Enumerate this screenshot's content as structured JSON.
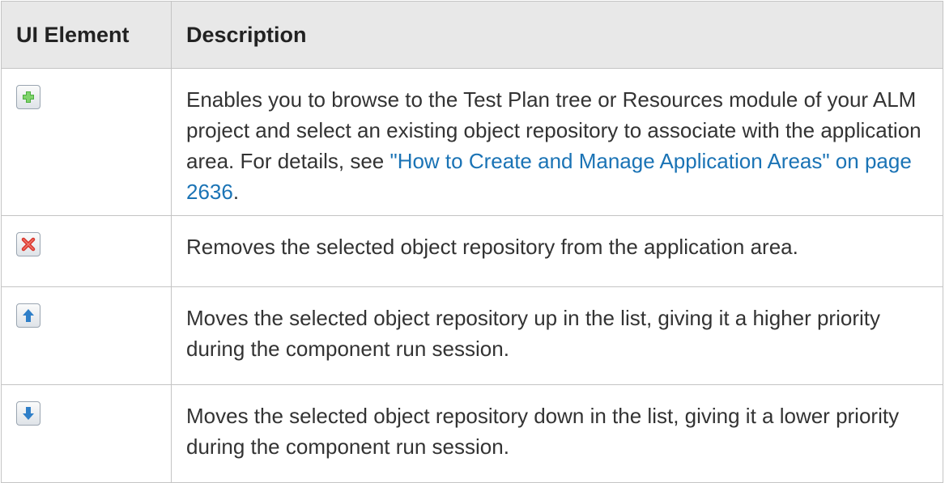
{
  "table": {
    "headers": {
      "element": "UI Element",
      "description": "Description"
    },
    "rows": [
      {
        "icon": "add-icon",
        "text": "Enables you to browse to the Test Plan tree or Resources module of your ALM project and select an existing object repository to associate with the application area. For details, see ",
        "link": "\"How to Create and Manage Application Areas\" on page 2636",
        "text_after": "."
      },
      {
        "icon": "remove-icon",
        "text": "Removes the selected object repository from the application area."
      },
      {
        "icon": "move-up-icon",
        "text": "Moves the selected object repository up in the list, giving it a higher priority during the component run session."
      },
      {
        "icon": "move-down-icon",
        "text": "Moves the selected object repository down in the list, giving it a lower priority during the component run session."
      }
    ]
  },
  "colors": {
    "link": "#1a73b5",
    "header_bg": "#e8e8e8",
    "add": "#4caf3f",
    "remove": "#d9342b",
    "arrow": "#2f7fc8"
  }
}
